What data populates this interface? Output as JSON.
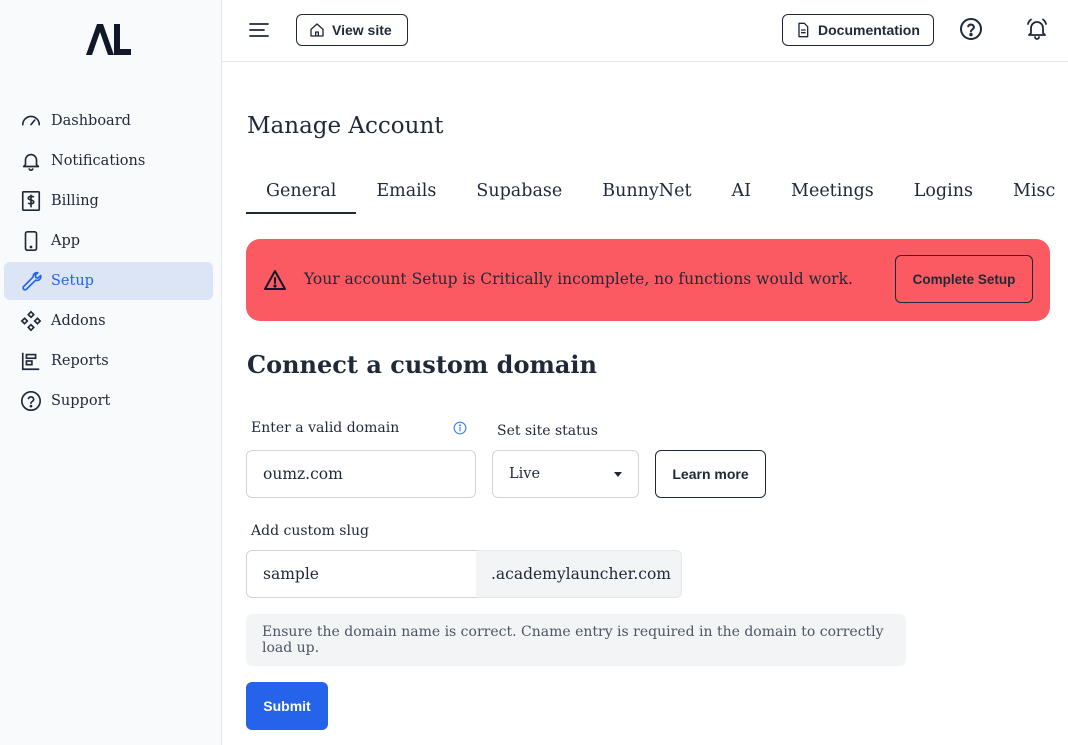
{
  "brand": {
    "logo_text": "AL"
  },
  "sidebar": {
    "items": [
      {
        "label": "Dashboard",
        "icon": "gauge-icon"
      },
      {
        "label": "Notifications",
        "icon": "bell-icon"
      },
      {
        "label": "Billing",
        "icon": "dollar-receipt-icon"
      },
      {
        "label": "App",
        "icon": "phone-icon"
      },
      {
        "label": "Setup",
        "icon": "wrench-icon",
        "active": true
      },
      {
        "label": "Addons",
        "icon": "addons-grid-icon"
      },
      {
        "label": "Reports",
        "icon": "report-chart-icon"
      },
      {
        "label": "Support",
        "icon": "question-circle-icon"
      }
    ],
    "active_color": "#2563eb",
    "active_bg": "#dbe5f6"
  },
  "header": {
    "view_site_label": "View site",
    "documentation_label": "Documentation"
  },
  "main": {
    "title": "Manage Account",
    "tabs": [
      {
        "label": "General",
        "active": true
      },
      {
        "label": "Emails"
      },
      {
        "label": "Supabase"
      },
      {
        "label": "BunnyNet"
      },
      {
        "label": "AI"
      },
      {
        "label": "Meetings"
      },
      {
        "label": "Logins"
      },
      {
        "label": "Misc"
      }
    ],
    "alert": {
      "message": "Your account Setup is Critically incomplete, no functions would work.",
      "action_label": "Complete Setup",
      "color": "#fb5a62"
    },
    "section_title": "Connect a custom domain",
    "domain": {
      "label": "Enter a valid domain",
      "value": "oumz.com"
    },
    "status": {
      "label": "Set site status",
      "selected": "Live"
    },
    "learn_more_label": "Learn more",
    "slug": {
      "label": "Add custom slug",
      "value": "sample",
      "suffix": ".academylauncher.com"
    },
    "note": "Ensure the domain name is correct. Cname entry is required in the domain to correctly load up.",
    "submit_label": "Submit",
    "submit_color": "#2563eb"
  }
}
